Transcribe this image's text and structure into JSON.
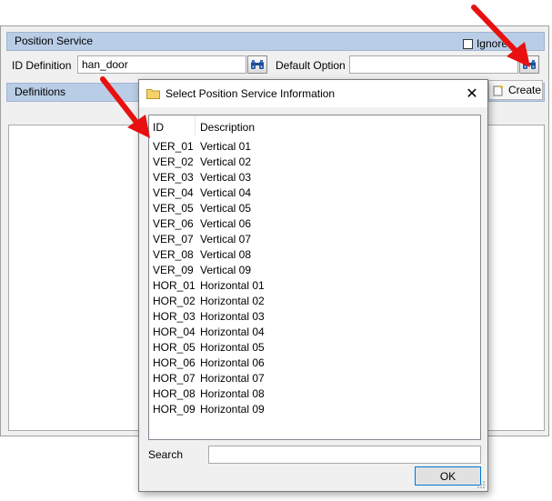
{
  "main": {
    "position_service": {
      "header": "Position Service",
      "ignore_label": "Ignore",
      "id_definition_label": "ID Definition",
      "id_definition_value": "han_door",
      "default_option_label": "Default Option",
      "default_option_value": ""
    },
    "definitions": {
      "header": "Definitions",
      "create_label": "Create"
    }
  },
  "dialog": {
    "title": "Select Position Service Information",
    "close_glyph": "✕",
    "columns": {
      "id": "ID",
      "description": "Description"
    },
    "rows": [
      {
        "id": "VER_01",
        "description": "Vertical 01"
      },
      {
        "id": "VER_02",
        "description": "Vertical 02"
      },
      {
        "id": "VER_03",
        "description": "Vertical 03"
      },
      {
        "id": "VER_04",
        "description": "Vertical 04"
      },
      {
        "id": "VER_05",
        "description": "Vertical 05"
      },
      {
        "id": "VER_06",
        "description": "Vertical 06"
      },
      {
        "id": "VER_07",
        "description": "Vertical 07"
      },
      {
        "id": "VER_08",
        "description": "Vertical 08"
      },
      {
        "id": "VER_09",
        "description": "Vertical 09"
      },
      {
        "id": "HOR_01",
        "description": "Horizontal 01"
      },
      {
        "id": "HOR_02",
        "description": "Horizontal 02"
      },
      {
        "id": "HOR_03",
        "description": "Horizontal 03"
      },
      {
        "id": "HOR_04",
        "description": "Horizontal 04"
      },
      {
        "id": "HOR_05",
        "description": "Horizontal 05"
      },
      {
        "id": "HOR_06",
        "description": "Horizontal 06"
      },
      {
        "id": "HOR_07",
        "description": "Horizontal 07"
      },
      {
        "id": "HOR_08",
        "description": "Horizontal 08"
      },
      {
        "id": "HOR_09",
        "description": "Horizontal 09"
      }
    ],
    "search_label": "Search",
    "search_value": "",
    "ok_label": "OK"
  },
  "icons": {
    "binoculars": "binoculars-icon",
    "create": "new-item-icon",
    "folder": "folder-icon",
    "close": "close-icon",
    "annotation": "red-arrow-annotation"
  },
  "colors": {
    "section_header": "#b9cde6",
    "arrow": "#e81010",
    "ok_border": "#0078d7"
  }
}
